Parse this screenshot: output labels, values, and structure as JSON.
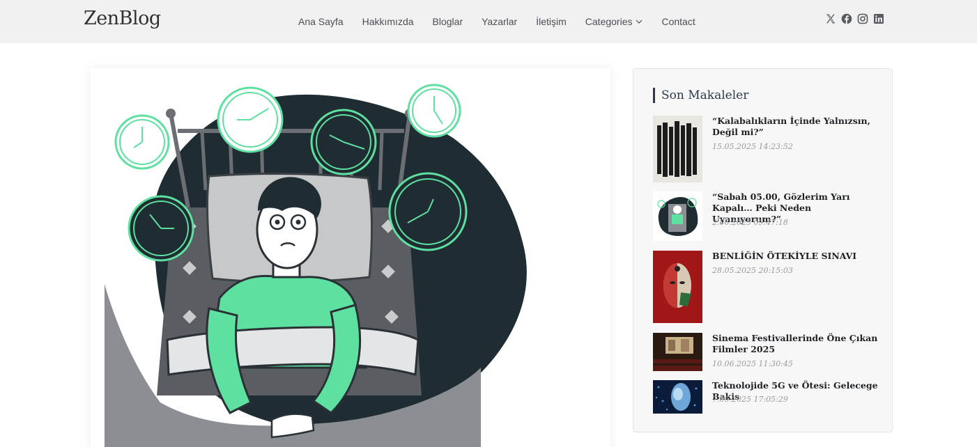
{
  "header": {
    "logo": "ZenBlog",
    "nav": [
      {
        "label": "Ana Sayfa"
      },
      {
        "label": "Hakkımızda"
      },
      {
        "label": "Bloglar"
      },
      {
        "label": "Yazarlar"
      },
      {
        "label": "İletişim"
      },
      {
        "label": "Categories"
      },
      {
        "label": "Contact"
      }
    ],
    "social": [
      "x-icon",
      "facebook-icon",
      "instagram-icon",
      "linkedin-icon"
    ]
  },
  "sidebar": {
    "title": "Son Makaleler",
    "posts": [
      {
        "title": "“Kalabalıkların İçinde Yalnızsın, Değil mi?”",
        "date": "15.05.2025 14:23:52"
      },
      {
        "title": "“Sabah 05.00, Gözlerim Yarı Kapalı… Peki Neden Uyanıyorum?”",
        "date": "2.06.2025 09:47:18"
      },
      {
        "title": "BENLİĞİN ÖTEKİYLE SINAVI",
        "date": "28.05.2025 20:15:03"
      },
      {
        "title": "Sinema Festivallerinde Öne Çıkan Filmler 2025",
        "date": "10.06.2025 11:30:45"
      },
      {
        "title": "Teknolojide 5G ve Ötesi: Gelecege Bakis",
        "date": "7.05.2025 17:05:29"
      }
    ]
  },
  "colors": {
    "header_bg": "#f1f1f1",
    "accent_green": "#5ee0a0",
    "dark_blob": "#1f2d33",
    "sidebar_bg": "#f7f7f7"
  }
}
